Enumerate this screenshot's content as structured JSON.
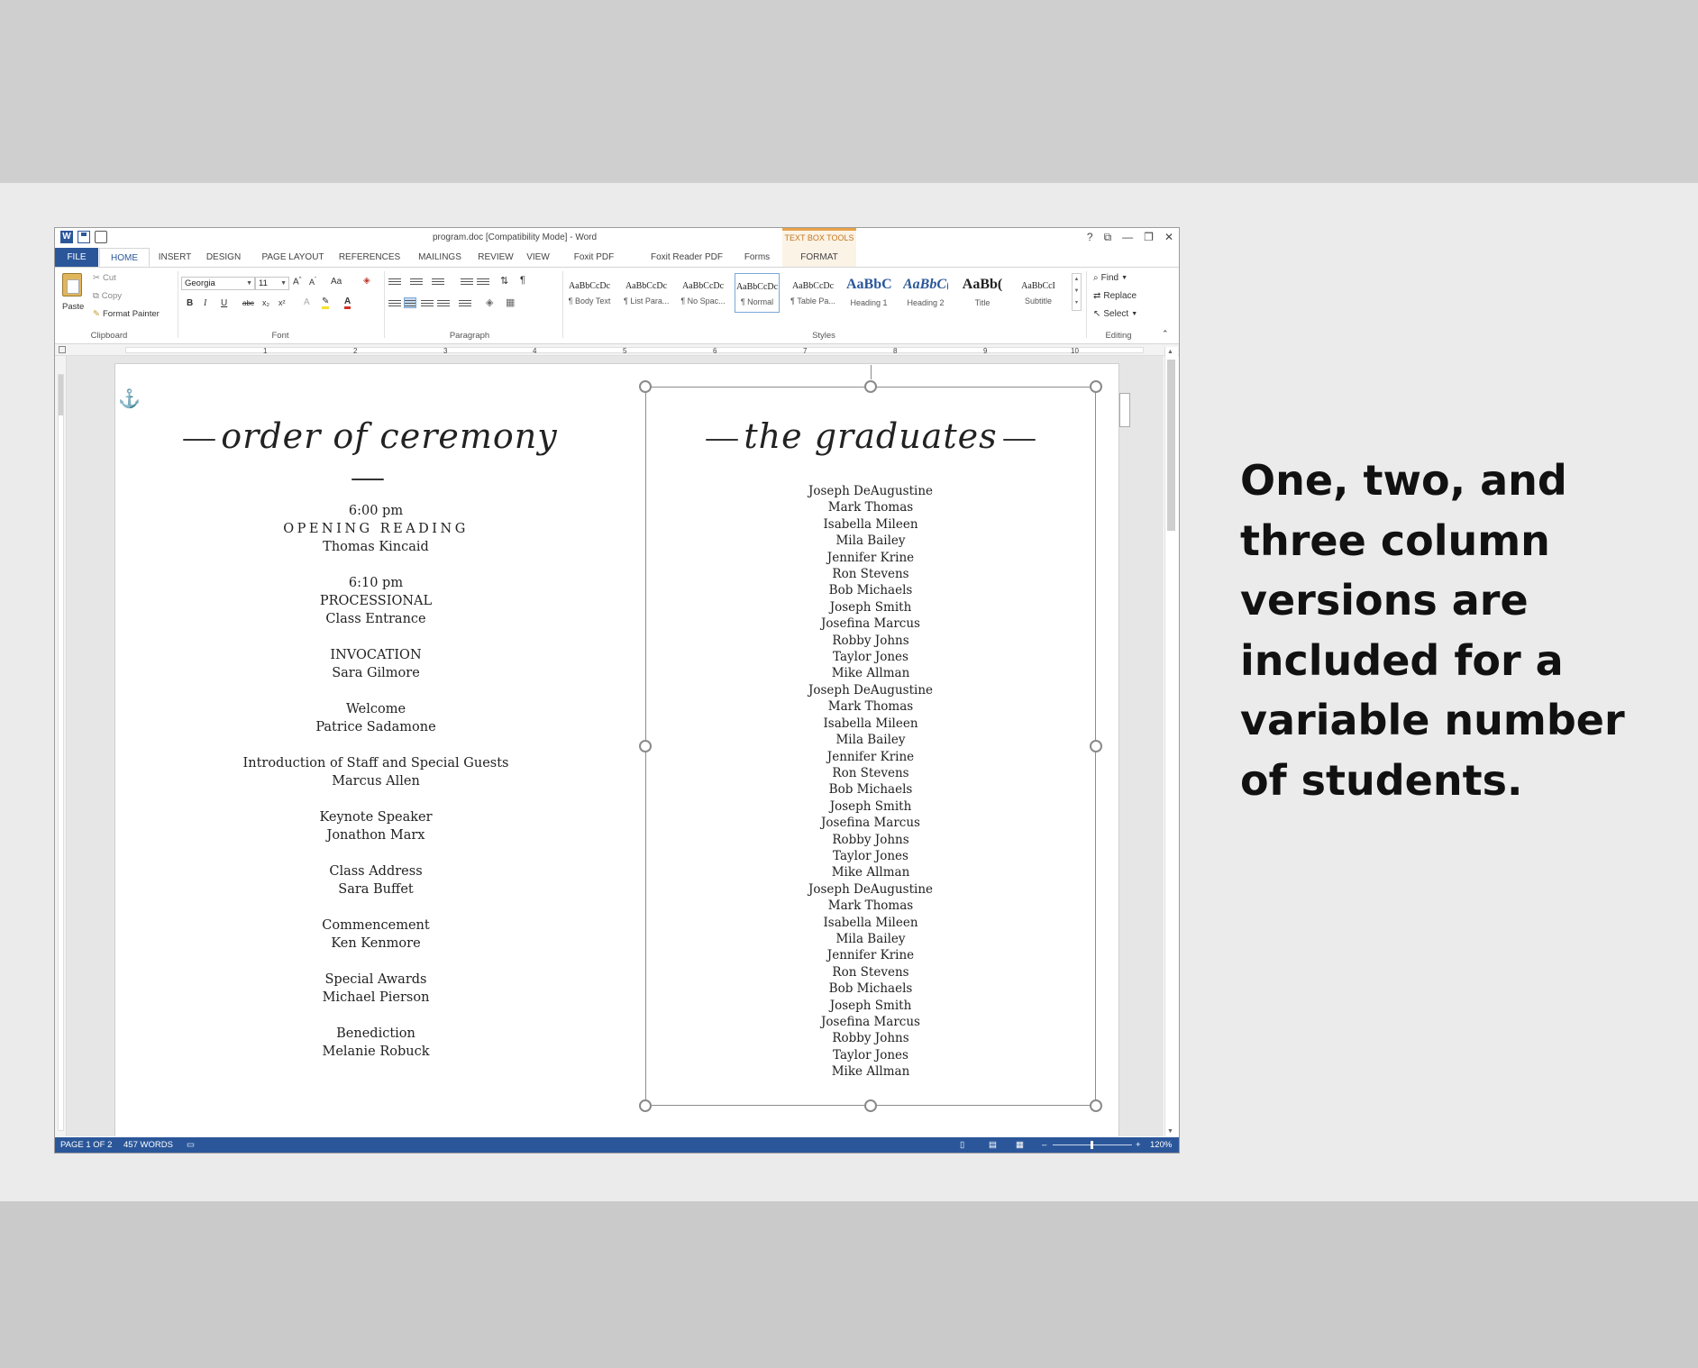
{
  "window": {
    "title": "program.doc [Compatibility Mode] - Word",
    "contextual_tab_group": "TEXT BOX TOOLS",
    "controls": [
      "?",
      "⧉",
      "—",
      "❐",
      "✕"
    ]
  },
  "tabs": [
    "FILE",
    "HOME",
    "INSERT",
    "DESIGN",
    "PAGE LAYOUT",
    "REFERENCES",
    "MAILINGS",
    "REVIEW",
    "VIEW",
    "Foxit PDF",
    "Foxit Reader PDF",
    "Forms",
    "FORMAT"
  ],
  "active_tab": "HOME",
  "ribbon": {
    "clipboard": {
      "paste": "Paste",
      "cut": "Cut",
      "copy": "Copy",
      "format_painter": "Format Painter",
      "label": "Clipboard"
    },
    "font": {
      "family": "Georgia",
      "size": "11",
      "case": "Aa",
      "bold": "B",
      "italic": "I",
      "underline": "U",
      "strike": "abc",
      "subscript": "x₂",
      "superscript": "x²",
      "label": "Font"
    },
    "paragraph": {
      "label": "Paragraph",
      "pilcrow": "¶"
    },
    "styles": {
      "items": [
        {
          "preview": "AaBbCcDc",
          "name": "¶ Body Text"
        },
        {
          "preview": "AaBbCcDc",
          "name": "¶ List Para..."
        },
        {
          "preview": "AaBbCcDc",
          "name": "¶ No Spac..."
        },
        {
          "preview": "AaBbCcDc",
          "name": "¶ Normal"
        },
        {
          "preview": "AaBbCcDc",
          "name": "¶ Table Pa..."
        },
        {
          "preview": "AaBbC(",
          "name": "Heading 1"
        },
        {
          "preview": "AaBbC(",
          "name": "Heading 2"
        },
        {
          "preview": "AaBb(",
          "name": "Title"
        },
        {
          "preview": "AaBbCcI",
          "name": "Subtitle"
        }
      ],
      "selected": "¶ Normal",
      "label": "Styles"
    },
    "editing": {
      "find": "Find",
      "replace": "Replace",
      "select": "Select",
      "label": "Editing"
    }
  },
  "ruler_numbers": [
    "1",
    "2",
    "3",
    "4",
    "5",
    "6",
    "7",
    "8",
    "9",
    "10"
  ],
  "document": {
    "left_title": "order of ceremony",
    "right_title": "the graduates",
    "program": [
      {
        "lines": [
          "6:00 pm",
          "OPENING READING",
          "Thomas Kincaid"
        ]
      },
      {
        "lines": [
          "6:10 pm",
          "PROCESSIONAL",
          "Class Entrance"
        ]
      },
      {
        "lines": [
          "INVOCATION",
          "Sara Gilmore"
        ]
      },
      {
        "lines": [
          "Welcome",
          "Patrice Sadamone"
        ]
      },
      {
        "lines": [
          "Introduction of Staff and Special Guests",
          "Marcus Allen"
        ]
      },
      {
        "lines": [
          "Keynote Speaker",
          "Jonathon Marx"
        ]
      },
      {
        "lines": [
          "Class Address",
          "Sara Buffet"
        ]
      },
      {
        "lines": [
          "Commencement",
          "Ken Kenmore"
        ]
      },
      {
        "lines": [
          "Special Awards",
          "Michael Pierson"
        ]
      },
      {
        "lines": [
          "Benediction",
          "Melanie Robuck"
        ]
      }
    ],
    "graduates": [
      "Joseph DeAugustine",
      "Mark Thomas",
      "Isabella Mileen",
      "Mila Bailey",
      "Jennifer Krine",
      "Ron Stevens",
      "Bob Michaels",
      "Joseph Smith",
      "Josefina Marcus",
      "Robby Johns",
      "Taylor Jones",
      "Mike Allman",
      "Joseph DeAugustine",
      "Mark Thomas",
      "Isabella Mileen",
      "Mila Bailey",
      "Jennifer Krine",
      "Ron Stevens",
      "Bob Michaels",
      "Joseph Smith",
      "Josefina Marcus",
      "Robby Johns",
      "Taylor Jones",
      "Mike Allman",
      "Joseph DeAugustine",
      "Mark Thomas",
      "Isabella Mileen",
      "Mila Bailey",
      "Jennifer Krine",
      "Ron Stevens",
      "Bob Michaels",
      "Joseph Smith",
      "Josefina Marcus",
      "Robby Johns",
      "Taylor Jones",
      "Mike Allman"
    ]
  },
  "status": {
    "page": "PAGE 1 OF 2",
    "words": "457 WORDS",
    "zoom": "120%"
  },
  "caption": "One, two, and three column versions are included for a variable number of students."
}
